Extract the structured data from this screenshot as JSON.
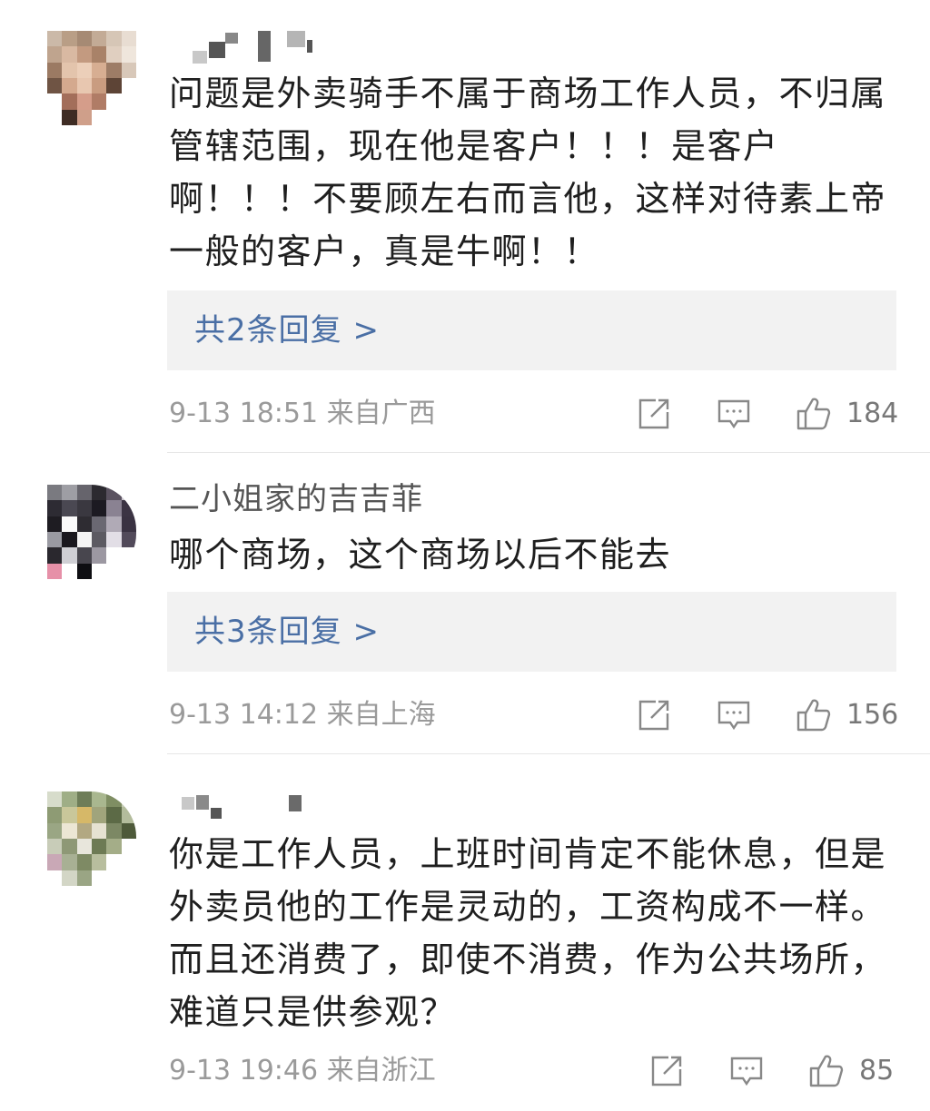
{
  "comments": [
    {
      "username": "",
      "text": "问题是外卖骑手不属于商场工作人员，不归属\n管辖范围，现在他是客户！！！是客户\n啊！！！不要顾左右而言他，这样对待素上帝\n一般的客户，真是牛啊！！",
      "replies_label": "共2条回复 >",
      "time": "9-13 18:51 来自广西",
      "likes": "184"
    },
    {
      "username": "二小姐家的吉吉菲",
      "text": "哪个商场，这个商场以后不能去",
      "replies_label": "共3条回复 >",
      "time": "9-13 14:12 来自上海",
      "likes": "156"
    },
    {
      "username": "",
      "text": "你是工作人员，上班时间肯定不能休息，但是\n外卖员他的工作是灵动的，工资构成不一样。\n而且还消费了，即使不消费，作为公共场所，\n难道只是供参观？",
      "time": "9-13 19:46 来自浙江",
      "likes": "85"
    }
  ],
  "icons": {
    "share": "share-icon",
    "comment": "comment-icon",
    "like": "thumbs-up-icon"
  },
  "colors": {
    "reply_link": "#4a6fa5",
    "reply_bg": "#f2f2f2",
    "meta_text": "#9a9a9a"
  }
}
